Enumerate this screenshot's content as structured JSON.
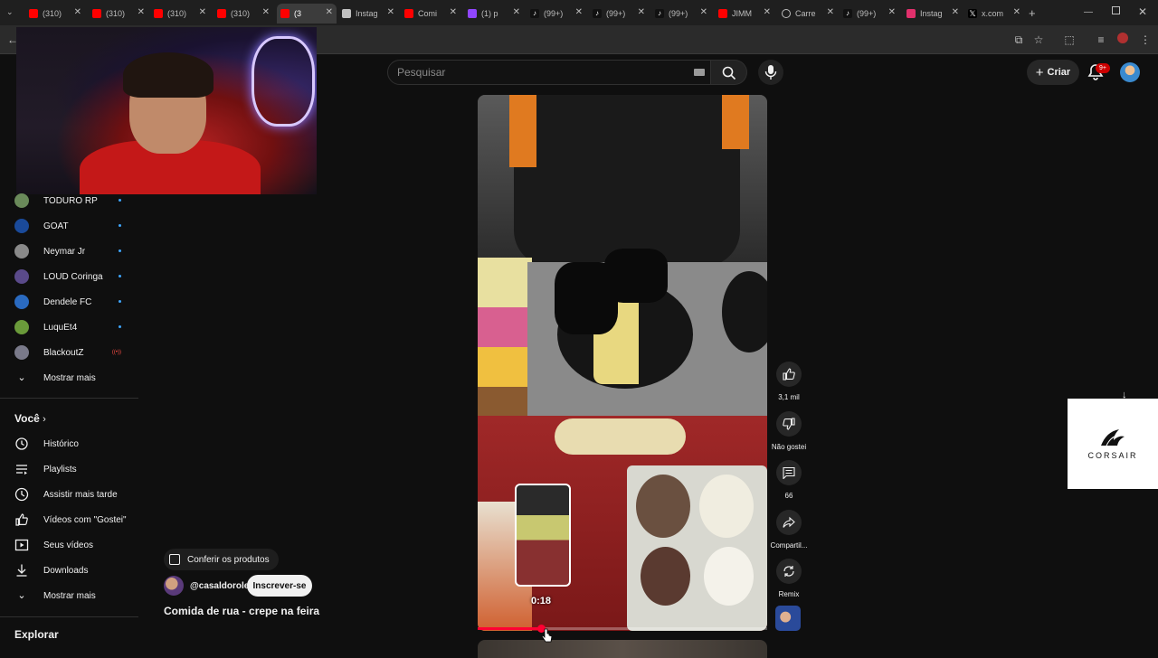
{
  "browser": {
    "tabs": [
      {
        "label": "(310)",
        "favicon": "youtube-icon",
        "active": false
      },
      {
        "label": "(310)",
        "favicon": "youtube-icon",
        "active": false
      },
      {
        "label": "(310)",
        "favicon": "youtube-icon",
        "active": false
      },
      {
        "label": "(310)",
        "favicon": "youtube-icon",
        "active": false
      },
      {
        "label": "(3",
        "favicon": "youtube-icon",
        "active": true
      },
      {
        "label": "Instag",
        "favicon": "google-lens-icon",
        "active": false
      },
      {
        "label": "Comi",
        "favicon": "youtube-icon",
        "active": false
      },
      {
        "label": "(1) p",
        "favicon": "twitch-icon",
        "active": false
      },
      {
        "label": "(99+)",
        "favicon": "tiktok-icon",
        "active": false
      },
      {
        "label": "(99+)",
        "favicon": "tiktok-icon",
        "active": false
      },
      {
        "label": "(99+)",
        "favicon": "tiktok-icon",
        "active": false
      },
      {
        "label": "JIMM",
        "favicon": "youtube-icon",
        "active": false
      },
      {
        "label": "Carre",
        "favicon": "loading-icon",
        "active": false
      },
      {
        "label": "(99+)",
        "favicon": "tiktok-icon",
        "active": false
      },
      {
        "label": "Instag",
        "favicon": "instagram-icon",
        "active": false
      },
      {
        "label": "x.com",
        "favicon": "x-icon",
        "active": false
      }
    ]
  },
  "header": {
    "search_placeholder": "Pesquisar",
    "create_label": "Criar",
    "notification_badge": "9+"
  },
  "sidebar": {
    "subscriptions": [
      {
        "name": "TODURO RP",
        "status": "new",
        "avatar_color": "#6a8a5a"
      },
      {
        "name": "GOAT",
        "status": "new",
        "avatar_color": "#1a4a9a"
      },
      {
        "name": "Neymar Jr",
        "status": "new",
        "avatar_color": "#8a8a8a"
      },
      {
        "name": "LOUD Coringa",
        "status": "new",
        "avatar_color": "#5a4a8a"
      },
      {
        "name": "Dendele FC",
        "status": "new",
        "avatar_color": "#2a6ac0"
      },
      {
        "name": "LuquEt4",
        "status": "new",
        "avatar_color": "#6a9a3a"
      },
      {
        "name": "BlackoutZ",
        "status": "live",
        "avatar_color": "#7a7a8a"
      }
    ],
    "subs_show_more": "Mostrar mais",
    "voce_title": "Você",
    "voce_items": [
      {
        "label": "Histórico",
        "icon": "history-icon"
      },
      {
        "label": "Playlists",
        "icon": "playlists-icon"
      },
      {
        "label": "Assistir mais tarde",
        "icon": "watch-later-icon"
      },
      {
        "label": "Vídeos com \"Gostei\"",
        "icon": "liked-videos-icon"
      },
      {
        "label": "Seus vídeos",
        "icon": "your-videos-icon"
      },
      {
        "label": "Downloads",
        "icon": "downloads-icon"
      }
    ],
    "voce_show_more": "Mostrar mais",
    "explorar_title": "Explorar"
  },
  "short": {
    "products_label": "Conferir os produtos",
    "channel_handle": "@casaldorole",
    "subscribe_label": "Inscrever-se",
    "title": "Comida de rua - crepe na feira",
    "progress_fraction": 0.22,
    "preview_time": "0:18"
  },
  "actions": {
    "like_count": "3,1 mil",
    "dislike_label": "Não gostei",
    "comments_count": "66",
    "share_label": "Compartil...",
    "remix_label": "Remix"
  },
  "ad": {
    "brand": "CORSAIR"
  },
  "colors": {
    "accent_red": "#ff0033",
    "background": "#0f0f0f"
  }
}
